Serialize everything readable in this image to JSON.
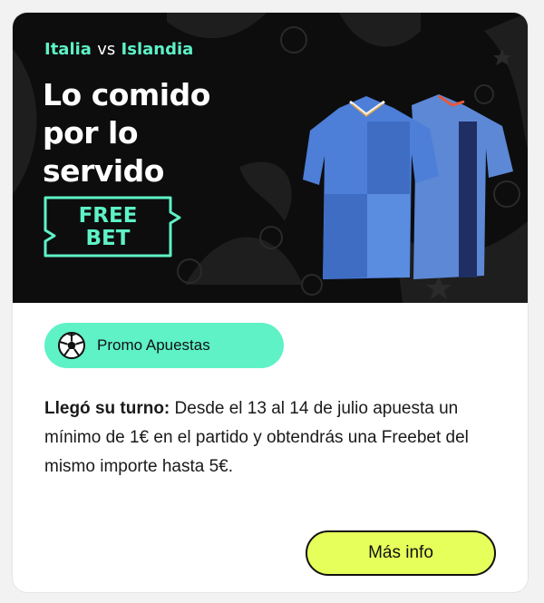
{
  "banner": {
    "team_home": "Italia",
    "vs": "vs",
    "team_away": "Islandia",
    "headline_lines": [
      "Lo comido",
      "por lo",
      "servido"
    ],
    "ticket_lines": [
      "FREE",
      "BET"
    ]
  },
  "promo": {
    "chip_label": "Promo Apuestas",
    "lead": "Llegó su turno:",
    "text": " Desde el 13 al 14 de julio apuesta un mínimo de 1€ en el partido y obtendrás una Freebet del mismo importe hasta 5€."
  },
  "cta": {
    "label": "Más info"
  },
  "colors": {
    "accent_mint": "#5ef2c6",
    "button_lime": "#e6ff5a",
    "banner_bg": "#0d0d0d"
  },
  "icons": {
    "chip_icon": "soccer-ball-icon"
  }
}
